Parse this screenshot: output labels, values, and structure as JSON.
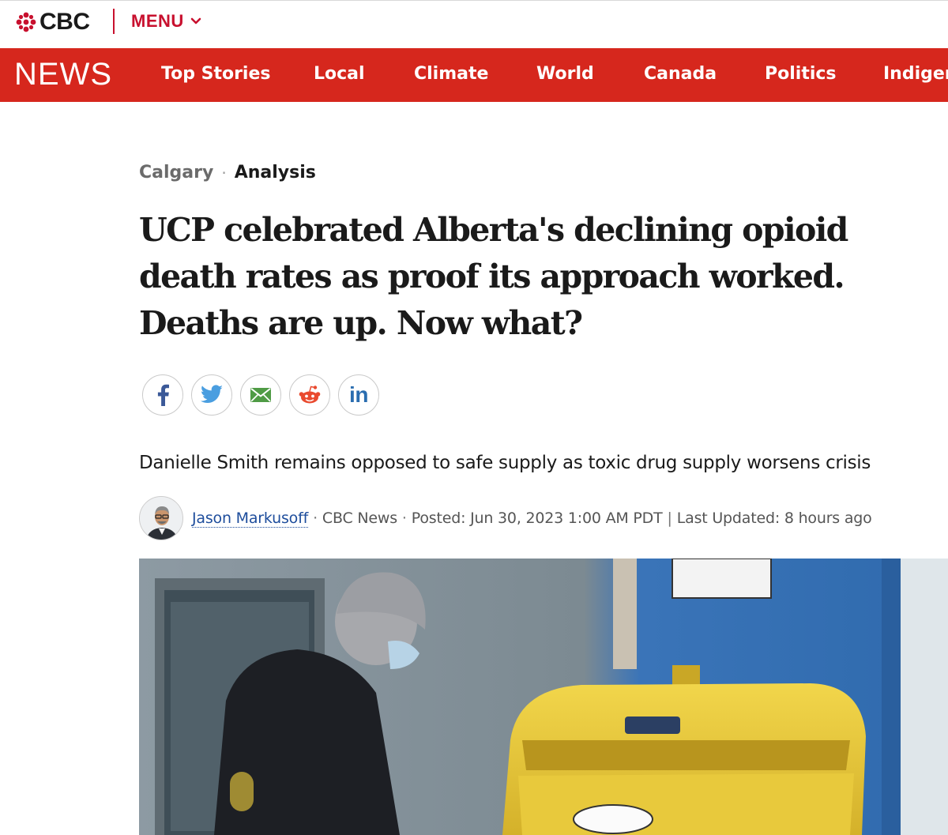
{
  "brand": {
    "logo_text": "CBC",
    "menu_label": "MENU",
    "accent_color": "#d6271d"
  },
  "nav": {
    "section_label": "NEWS",
    "items": [
      {
        "label": "Top Stories"
      },
      {
        "label": "Local"
      },
      {
        "label": "Climate"
      },
      {
        "label": "World"
      },
      {
        "label": "Canada"
      },
      {
        "label": "Politics"
      },
      {
        "label": "Indigenous"
      }
    ]
  },
  "article": {
    "section": "Calgary",
    "label": "Analysis",
    "headline": "UCP celebrated Alberta's declining opioid death rates as proof its approach worked. Deaths are up. Now what?",
    "deck": "Danielle Smith remains opposed to safe supply as toxic drug supply worsens crisis",
    "share_icons": [
      "facebook-icon",
      "twitter-icon",
      "email-icon",
      "reddit-icon",
      "linkedin-icon"
    ],
    "share_labels": {
      "linkedin": "in"
    },
    "byline": {
      "author": "Jason Markusoff",
      "outlet": "CBC News",
      "posted": "Posted: Jun 30, 2023 1:00 AM PDT",
      "updated": "Last Updated: 8 hours ago",
      "separator": "|",
      "dot": "·"
    }
  }
}
